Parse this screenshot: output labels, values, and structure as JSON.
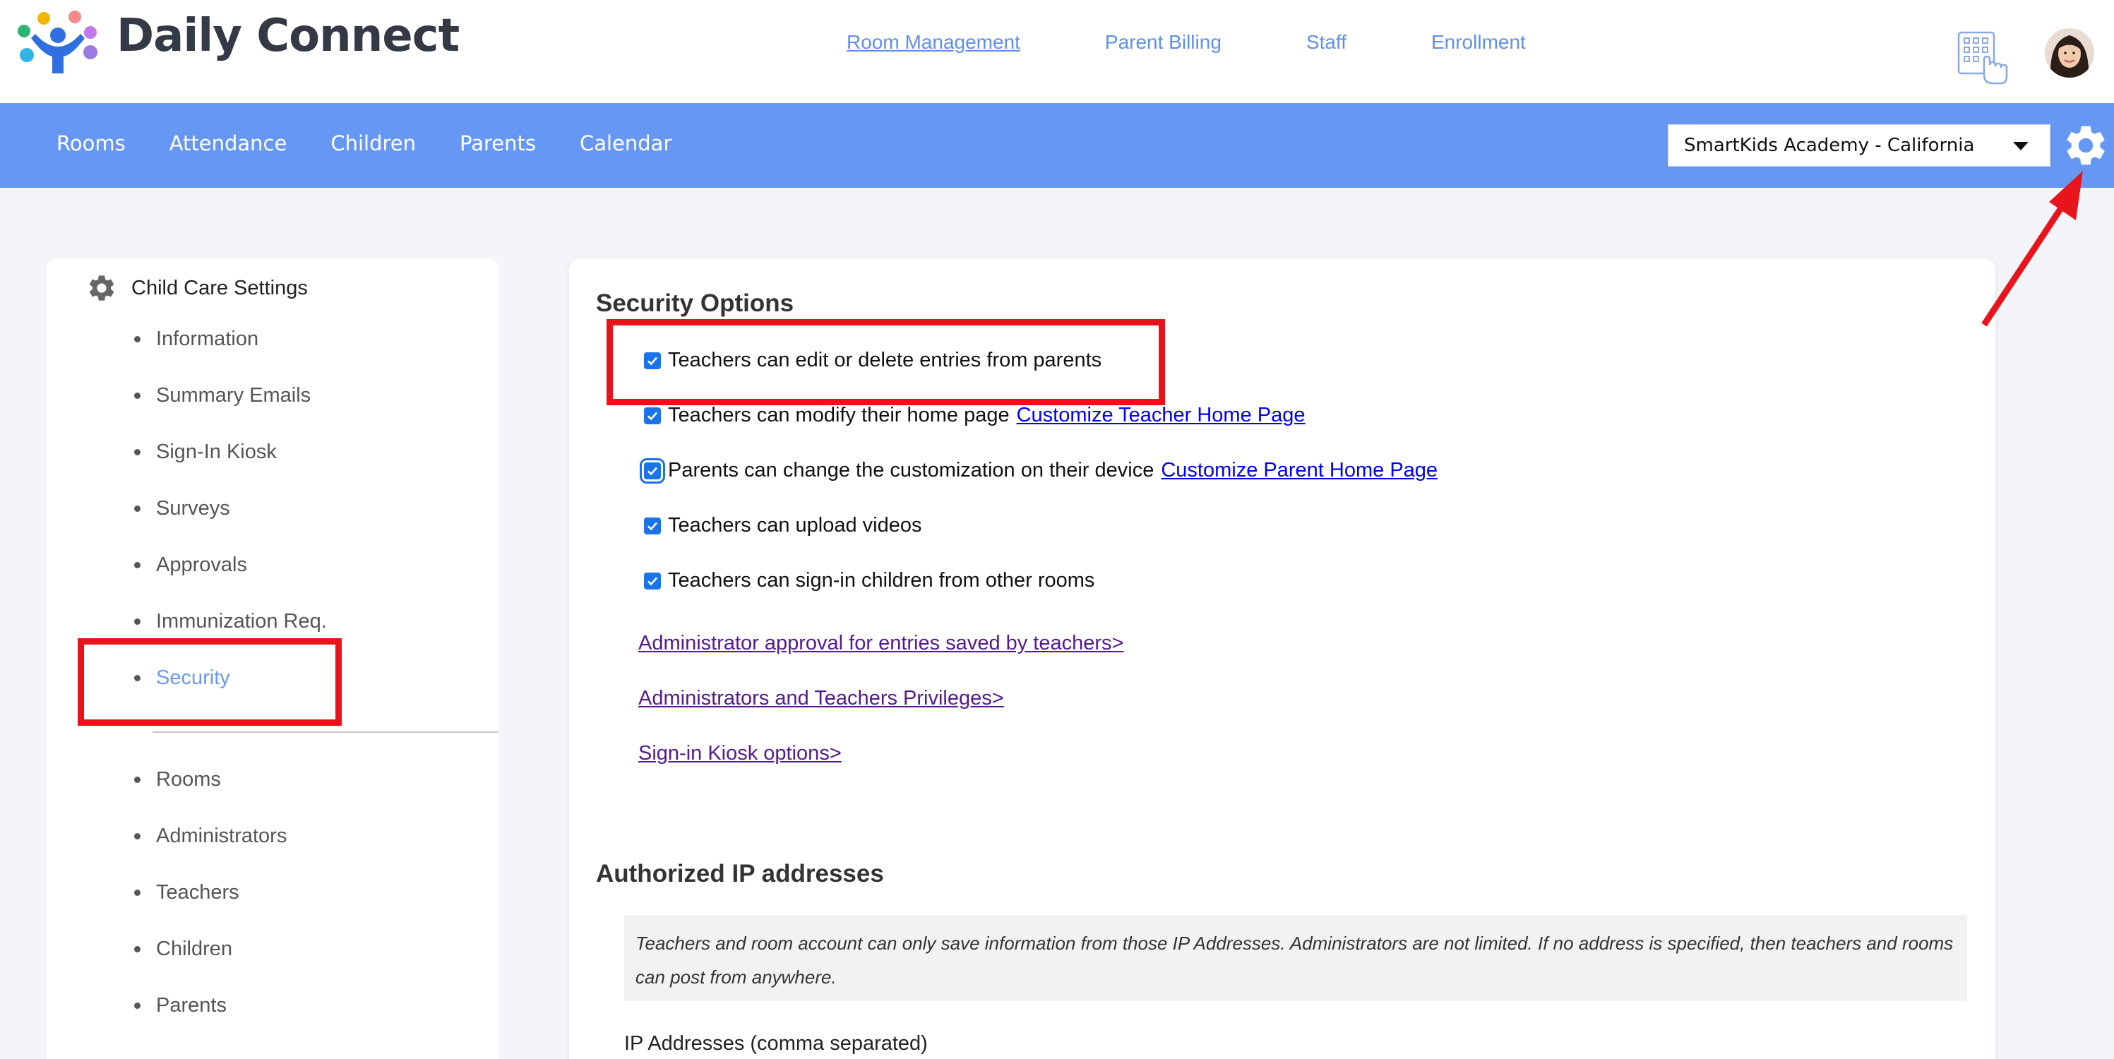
{
  "app": {
    "name": "Daily Connect"
  },
  "top_links": [
    {
      "label": "Room Management"
    },
    {
      "label": "Parent Billing"
    },
    {
      "label": "Staff"
    },
    {
      "label": "Enrollment"
    }
  ],
  "nav": {
    "items": [
      {
        "label": "Rooms"
      },
      {
        "label": "Attendance"
      },
      {
        "label": "Children"
      },
      {
        "label": "Parents"
      },
      {
        "label": "Calendar"
      }
    ],
    "school_select": "SmartKids Academy - California"
  },
  "sidebar": {
    "heading": "Child Care Settings",
    "items": [
      {
        "label": "Information"
      },
      {
        "label": "Summary Emails"
      },
      {
        "label": "Sign-In Kiosk"
      },
      {
        "label": "Surveys"
      },
      {
        "label": "Approvals"
      },
      {
        "label": "Immunization Req."
      },
      {
        "label": "Security",
        "active": true
      }
    ],
    "items2": [
      {
        "label": "Rooms"
      },
      {
        "label": "Administrators"
      },
      {
        "label": "Teachers"
      },
      {
        "label": "Children"
      },
      {
        "label": "Parents"
      }
    ]
  },
  "security": {
    "title": "Security Options",
    "options": [
      {
        "label": "Teachers can edit or delete entries from parents",
        "checked": true
      },
      {
        "label": "Teachers can modify their home page",
        "checked": true,
        "link": "Customize Teacher Home Page"
      },
      {
        "label": "Parents can change the customization on their device",
        "checked": true,
        "link": "Customize Parent Home Page"
      },
      {
        "label": "Teachers can upload videos",
        "checked": true
      },
      {
        "label": "Teachers can sign-in children from other rooms",
        "checked": true
      }
    ],
    "links": [
      {
        "label": "Administrator approval for entries saved by teachers>"
      },
      {
        "label": "Administrators and Teachers Privileges>"
      },
      {
        "label": "Sign-in Kiosk options>"
      }
    ]
  },
  "ip": {
    "title": "Authorized IP addresses",
    "note": "Teachers and room account can only save information from those IP Addresses. Administrators are not limited. If no address is specified, then teachers and rooms can post from anywhere.",
    "field_label": "IP Addresses (comma separated)"
  },
  "colors": {
    "nav_blue": "#6698f3",
    "link_blue": "#5f8fea",
    "annotation_red": "#e8141c",
    "checkbox_blue": "#1a73e8"
  }
}
